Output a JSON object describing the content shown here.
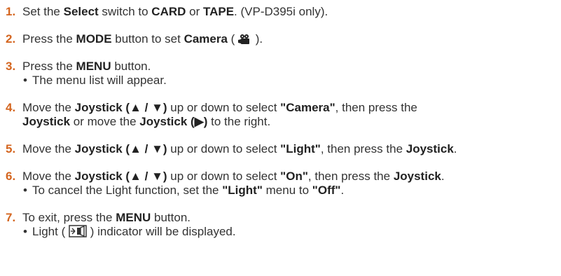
{
  "colors": {
    "step_number": "#d4651f",
    "text": "#333333"
  },
  "steps": [
    {
      "number": "1.",
      "t1": "Set the ",
      "b1": "Select",
      "t2": " switch to ",
      "b2": "CARD",
      "t3": " or ",
      "b3": "TAPE",
      "t4": ". (VP-D395i only)."
    },
    {
      "number": "2.",
      "t1": "Press the ",
      "b1": "MODE",
      "t2": " button to set ",
      "b2": "Camera",
      "t3": " ( ",
      "icon": "camera-icon",
      "t4": " )."
    },
    {
      "number": "3.",
      "t1": "Press the ",
      "b1": "MENU",
      "t2": " button.",
      "bullet_dot": "•",
      "bullet": "The menu list will appear."
    },
    {
      "number": "4.",
      "t1": "Move the ",
      "b1": "Joystick (▲ / ▼)",
      "t2": " up or down to select ",
      "b2": "\"Camera\"",
      "t3": ", then press the",
      "l2_b1": "Joystick",
      "l2_t1": " or move the ",
      "l2_b2": "Joystick (▶)",
      "l2_t2": " to the right."
    },
    {
      "number": "5.",
      "t1": "Move the ",
      "b1": "Joystick (▲ / ▼)",
      "t2": " up or down to select ",
      "b2": "\"Light\"",
      "t3": ", then press the ",
      "b3": "Joystick",
      "t4": "."
    },
    {
      "number": "6.",
      "t1": "Move the ",
      "b1": "Joystick (▲ / ▼)",
      "t2": " up or down to select ",
      "b2": "\"On\"",
      "t3": ", then press the ",
      "b3": "Joystick",
      "t4": ".",
      "bullet_dot": "•",
      "bullet_t1": "To cancel the Light function, set the ",
      "bullet_b1": "\"Light\"",
      "bullet_t2": " menu to ",
      "bullet_b2": "\"Off\"",
      "bullet_t3": "."
    },
    {
      "number": "7.",
      "t1": "To exit, press the ",
      "b1": "MENU",
      "t2": " button.",
      "bullet_dot": "•",
      "bullet_t1": "Light ( ",
      "icon": "light-indicator-icon",
      "bullet_t2": " ) indicator will be displayed."
    }
  ]
}
